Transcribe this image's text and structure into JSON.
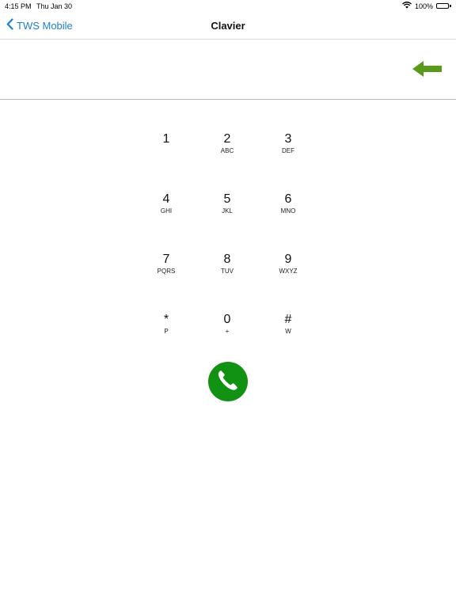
{
  "status_bar": {
    "time": "4:15 PM",
    "date": "Thu Jan 30",
    "battery": "100%"
  },
  "nav": {
    "back_label": "TWS Mobile",
    "title": "Clavier"
  },
  "display": {
    "number": ""
  },
  "keypad": {
    "keys": [
      {
        "digit": "1",
        "letters": ""
      },
      {
        "digit": "2",
        "letters": "ABC"
      },
      {
        "digit": "3",
        "letters": "DEF"
      },
      {
        "digit": "4",
        "letters": "GHI"
      },
      {
        "digit": "5",
        "letters": "JKL"
      },
      {
        "digit": "6",
        "letters": "MNO"
      },
      {
        "digit": "7",
        "letters": "PQRS"
      },
      {
        "digit": "8",
        "letters": "TUV"
      },
      {
        "digit": "9",
        "letters": "WXYZ"
      },
      {
        "digit": "*",
        "letters": "P"
      },
      {
        "digit": "0",
        "letters": "+"
      },
      {
        "digit": "#",
        "letters": "W"
      }
    ]
  },
  "colors": {
    "accent": "#1a7fd6",
    "backspace": "#5a9a1a",
    "call": "#129212"
  },
  "icons": {
    "back": "chevron-left-icon",
    "backspace": "arrow-left-icon",
    "call": "phone-icon",
    "wifi": "wifi-icon",
    "battery": "battery-icon"
  }
}
